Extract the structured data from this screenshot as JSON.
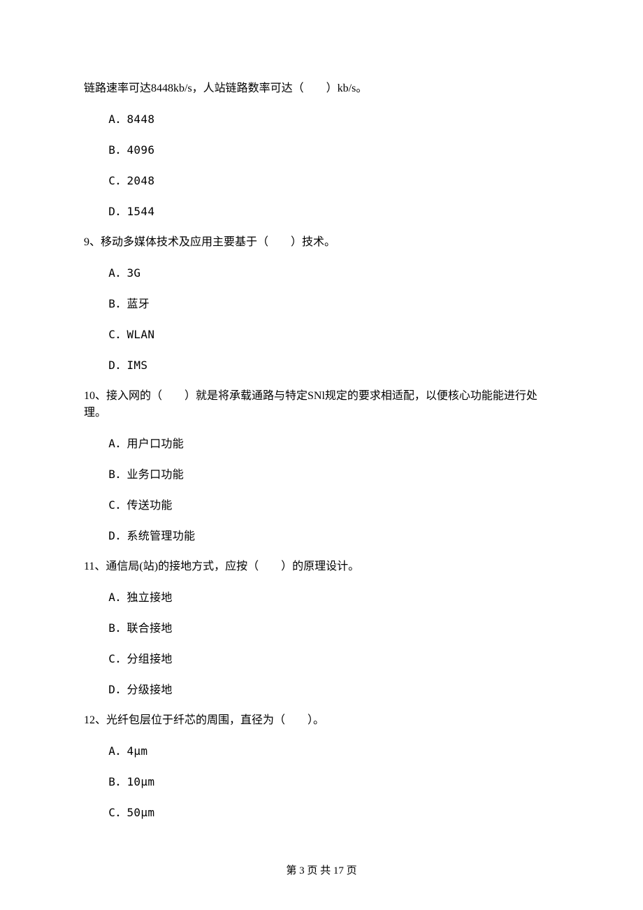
{
  "intro": "链路速率可达8448kb/s，人站链路数率可达（　　）kb/s。",
  "q8": {
    "opts": [
      "A．8448",
      "B．4096",
      "C．2048",
      "D．1544"
    ]
  },
  "q9": {
    "stem": "9、移动多媒体技术及应用主要基于（　　）技术。",
    "opts": [
      "A．3G",
      "B．蓝牙",
      "C．WLAN",
      "D．IMS"
    ]
  },
  "q10": {
    "stem": "10、接入网的（　　）就是将承载通路与特定SNl规定的要求相适配，以便核心功能能进行处理。",
    "opts": [
      "A．用户口功能",
      "B．业务口功能",
      "C．传送功能",
      "D．系统管理功能"
    ]
  },
  "q11": {
    "stem": "11、通信局(站)的接地方式，应按（　　）的原理设计。",
    "opts": [
      "A．独立接地",
      "B．联合接地",
      "C．分组接地",
      "D．分级接地"
    ]
  },
  "q12": {
    "stem": "12、光纤包层位于纤芯的周围，直径为（　　）。",
    "opts": [
      "A．4μm",
      "B．10μm",
      "C．50μm"
    ]
  },
  "footer": "第 3 页 共 17 页"
}
